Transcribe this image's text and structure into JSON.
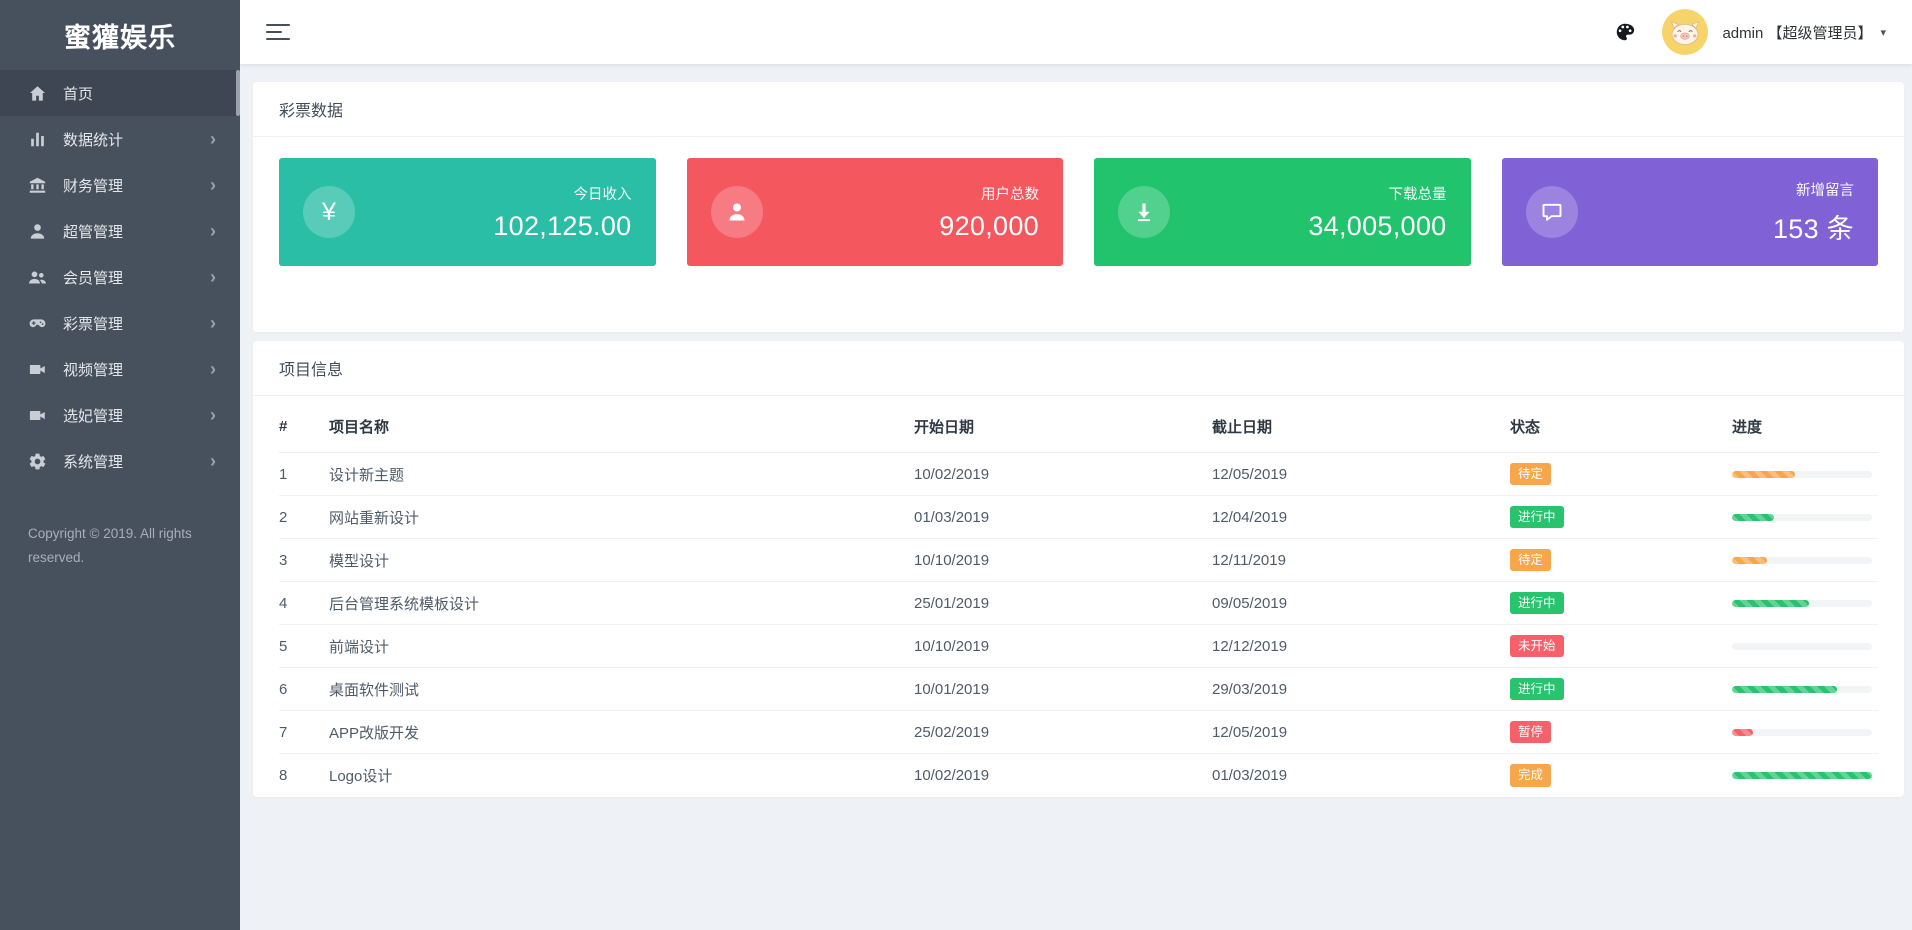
{
  "app": {
    "logo_text": "蜜獾娱乐",
    "copyright": "Copyright © 2019. All rights reserved."
  },
  "header": {
    "icons": [
      "menu-icon",
      "palette-icon"
    ],
    "user_name": "admin 【超级管理员】",
    "caret": "▾"
  },
  "colors": {
    "sidebar_bg": "#47505d",
    "sidebar_active_bg": "#3e4653",
    "page_bg": "#eef1f5",
    "teal": "#2bbea6",
    "card_red": "#f5575f",
    "card_green": "#22c36d",
    "purple": "#8161d6",
    "orange": "#f7a64b",
    "green": "#28c36d",
    "red": "#f5606a"
  },
  "sidebar": {
    "items": [
      {
        "icon": "home-icon",
        "label": "首页",
        "active": true,
        "arrow": false
      },
      {
        "icon": "bar-chart-icon",
        "label": "数据统计",
        "active": false,
        "arrow": true
      },
      {
        "icon": "bank-icon",
        "label": "财务管理",
        "active": false,
        "arrow": true
      },
      {
        "icon": "user-icon",
        "label": "超管管理",
        "active": false,
        "arrow": true
      },
      {
        "icon": "users-icon",
        "label": "会员管理",
        "active": false,
        "arrow": true
      },
      {
        "icon": "gamepad-icon",
        "label": "彩票管理",
        "active": false,
        "arrow": true
      },
      {
        "icon": "video-icon",
        "label": "视频管理",
        "active": false,
        "arrow": true
      },
      {
        "icon": "video-icon",
        "label": "选妃管理",
        "active": false,
        "arrow": true
      },
      {
        "icon": "gear-icon",
        "label": "系统管理",
        "active": false,
        "arrow": true
      }
    ]
  },
  "stats": {
    "panel_title": "彩票数据",
    "cards": [
      {
        "icon": "yen-icon",
        "label": "今日收入",
        "value": "102,125.00",
        "color": "teal"
      },
      {
        "icon": "person-icon",
        "label": "用户总数",
        "value": "920,000",
        "color": "card_red"
      },
      {
        "icon": "download-icon",
        "label": "下载总量",
        "value": "34,005,000",
        "color": "card_green"
      },
      {
        "icon": "chat-icon",
        "label": "新增留言",
        "value": "153 条",
        "color": "purple"
      }
    ]
  },
  "projects": {
    "panel_title": "项目信息",
    "columns": [
      "#",
      "项目名称",
      "开始日期",
      "截止日期",
      "状态",
      "进度"
    ],
    "rows": [
      {
        "id": "1",
        "name": "设计新主题",
        "start": "10/02/2019",
        "end": "12/05/2019",
        "status": "待定",
        "status_color": "orange",
        "progress": 45,
        "progress_color": "orange"
      },
      {
        "id": "2",
        "name": "网站重新设计",
        "start": "01/03/2019",
        "end": "12/04/2019",
        "status": "进行中",
        "status_color": "green",
        "progress": 30,
        "progress_color": "green"
      },
      {
        "id": "3",
        "name": "模型设计",
        "start": "10/10/2019",
        "end": "12/11/2019",
        "status": "待定",
        "status_color": "orange",
        "progress": 25,
        "progress_color": "orange"
      },
      {
        "id": "4",
        "name": "后台管理系统模板设计",
        "start": "25/01/2019",
        "end": "09/05/2019",
        "status": "进行中",
        "status_color": "green",
        "progress": 55,
        "progress_color": "green"
      },
      {
        "id": "5",
        "name": "前端设计",
        "start": "10/10/2019",
        "end": "12/12/2019",
        "status": "未开始",
        "status_color": "red",
        "progress": 0,
        "progress_color": "red"
      },
      {
        "id": "6",
        "name": "桌面软件测试",
        "start": "10/01/2019",
        "end": "29/03/2019",
        "status": "进行中",
        "status_color": "green",
        "progress": 75,
        "progress_color": "green"
      },
      {
        "id": "7",
        "name": "APP改版开发",
        "start": "25/02/2019",
        "end": "12/05/2019",
        "status": "暂停",
        "status_color": "red",
        "progress": 15,
        "progress_color": "red"
      },
      {
        "id": "8",
        "name": "Logo设计",
        "start": "10/02/2019",
        "end": "01/03/2019",
        "status": "完成",
        "status_color": "orange",
        "progress": 100,
        "progress_color": "green"
      }
    ]
  }
}
